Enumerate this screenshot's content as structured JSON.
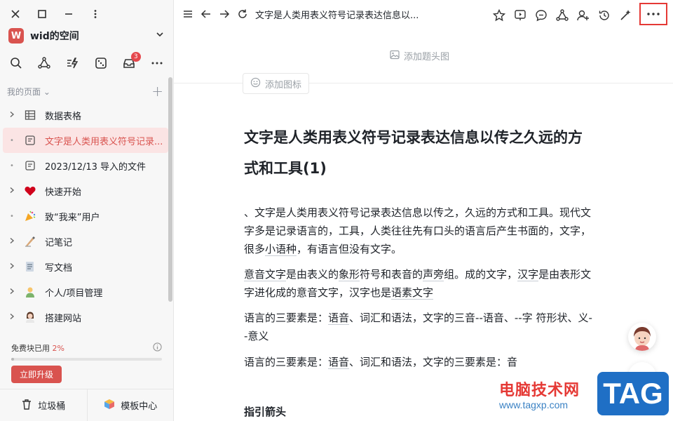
{
  "sidebar": {
    "space_initial": "W",
    "space_name": "wid的空间",
    "notification_count": "3",
    "section_title": "我的页面",
    "items": [
      {
        "label": "数据表格",
        "icon": "table-icon",
        "expandable": true
      },
      {
        "label": "文字是人类用表义符号记录...",
        "icon": "doc-icon",
        "expandable": false,
        "active": true
      },
      {
        "label": "2023/12/13 导入的文件",
        "icon": "doc-icon",
        "expandable": false
      },
      {
        "label": "快速开始",
        "icon": "heart-icon",
        "expandable": true
      },
      {
        "label": "致“我来”用户",
        "icon": "party-popper-icon",
        "expandable": false
      },
      {
        "label": "记笔记",
        "icon": "writing-hand-icon",
        "expandable": true
      },
      {
        "label": "写文档",
        "icon": "document-icon",
        "expandable": true
      },
      {
        "label": "个人/项目管理",
        "icon": "person-icon",
        "expandable": true
      },
      {
        "label": "搭建网站",
        "icon": "woman-icon",
        "expandable": true
      }
    ],
    "usage_label": "免费块已用",
    "usage_pct": "2%",
    "usage_fraction": 0.02,
    "upgrade_label": "立即升级",
    "trash_label": "垃圾桶",
    "templates_label": "模板中心"
  },
  "topbar": {
    "doc_title": "文字是人类用表义符号记录表达信息以..."
  },
  "content": {
    "add_cover": "添加题头图",
    "add_icon": "添加图标",
    "title": "文字是人类用表义符号记录表达信息以传之久远的方式和工具(1)",
    "p1_a": "、文字是人类用表义符号记录表达信息以传之，久远的方式和工具。现代文字多是记录语言的，工具，人类往往先有口头的语言后产生书面的，文字，很多",
    "p1_link": "小语种",
    "p1_b": "，有语言但没有文字。",
    "p2_link1": "意音文字",
    "p2_a": "是由表义的",
    "p2_link2": "象形",
    "p2_b": "符号和表音的",
    "p2_link3": "声旁",
    "p2_c": "组。成的文字，",
    "p2_link4": "汉字",
    "p2_d": "是由表形文字进化成的意音文字，汉字也是",
    "p2_link5": "语素文字",
    "p3_a": "语言的三要素是：",
    "p3_link": "语音",
    "p3_b": "、词汇和语法，文字的三音--语音、--字 符形状、义--意义",
    "p4_a": "语言的三要素是：",
    "p4_link": "语音",
    "p4_b": "、词汇和语法，文字的三要素是：音",
    "h3": "指引箭头",
    "help": "?"
  },
  "watermark": {
    "site_name": "电脑技术网",
    "url": "www.tagxp.com",
    "tag": "TAG"
  }
}
